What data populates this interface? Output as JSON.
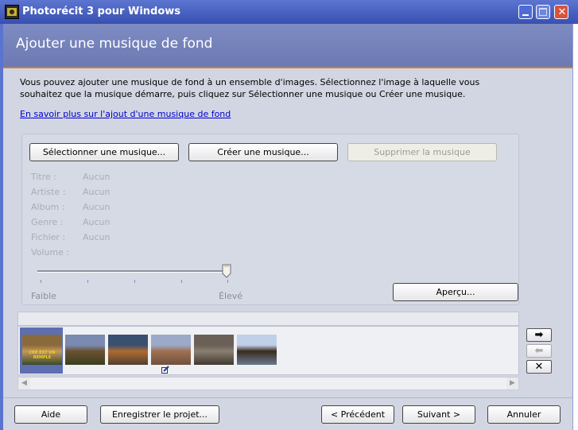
{
  "window": {
    "title": "Photorécit 3 pour Windows"
  },
  "header": {
    "title": "Ajouter une musique de fond"
  },
  "intro": {
    "description": "Vous pouvez ajouter une musique de fond à un ensemble d'images. Sélectionnez l'image à laquelle vous souhaitez que la musique démarre, puis cliquez sur Sélectionner une musique ou Créer une musique.",
    "link": "En savoir plus sur l'ajout d'une musique de fond"
  },
  "music_buttons": {
    "select": "Sélectionner une musique...",
    "create": "Créer une musique...",
    "delete": "Supprimer la musique"
  },
  "info": {
    "title_label": "Titre :",
    "title_value": "Aucun",
    "artist_label": "Artiste :",
    "artist_value": "Aucun",
    "album_label": "Album :",
    "album_value": "Aucun",
    "genre_label": "Genre :",
    "genre_value": "Aucun",
    "file_label": "Fichier :",
    "file_value": "Aucun",
    "volume_label": "Volume :"
  },
  "volume": {
    "min_label": "Faible",
    "max_label": "Élevé",
    "level": 1.0
  },
  "preview_button": "Aperçu...",
  "thumbnails": [
    {
      "selected": true,
      "caption": "CRÉ EST UN REMPLE",
      "colors": [
        "#8a6a3a",
        "#c49a5a",
        "#3a4a2a"
      ]
    },
    {
      "selected": false,
      "colors": [
        "#7a8ab0",
        "#6a5030",
        "#3a4020"
      ]
    },
    {
      "selected": false,
      "colors": [
        "#3a5070",
        "#b06a30",
        "#504030"
      ]
    },
    {
      "selected": false,
      "colors": [
        "#9aaac8",
        "#a07050",
        "#705040"
      ]
    },
    {
      "selected": false,
      "colors": [
        "#6a6058",
        "#8a8070",
        "#403830"
      ]
    },
    {
      "selected": false,
      "colors": [
        "#c0d0e8",
        "#3a2a20",
        "#6a7a90"
      ]
    }
  ],
  "footer": {
    "help": "Aide",
    "save": "Enregistrer le projet...",
    "back": "< Précédent",
    "next": "Suivant >",
    "cancel": "Annuler"
  },
  "colors": {
    "titlebar": "#3850b2",
    "header": "#7582ba",
    "accent": "#d8792f",
    "content": "#d2d6e2"
  }
}
